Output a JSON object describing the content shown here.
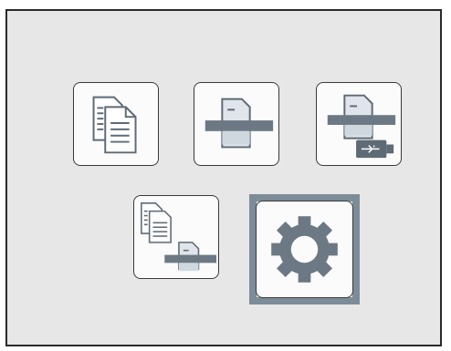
{
  "screen": {
    "tiles": [
      {
        "id": "copy",
        "icon": "copy-icon"
      },
      {
        "id": "scan",
        "icon": "scanner-icon"
      },
      {
        "id": "scan-to-usb",
        "icon": "scan-to-usb-icon"
      },
      {
        "id": "copy-and-scan",
        "icon": "copy-scan-icon"
      },
      {
        "id": "settings",
        "icon": "gear-icon",
        "selected": true
      }
    ],
    "colors": {
      "panel_bg": "#e7e7e7",
      "tile_bg": "#fbfbfb",
      "icon_fill": "#6c7984",
      "icon_dark": "#4f5b66",
      "selection": "#7d8c99"
    }
  }
}
